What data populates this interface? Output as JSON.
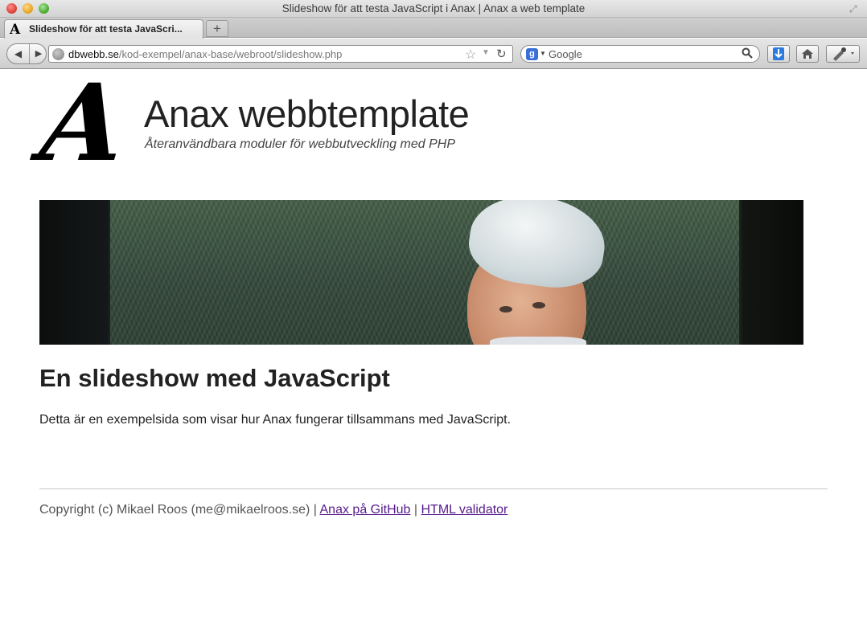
{
  "window": {
    "title": "Slideshow för att testa JavaScript i Anax | Anax a web template"
  },
  "tab": {
    "favicon_letter": "A",
    "title": "Slideshow för att testa JavaScri..."
  },
  "new_tab_label": "+",
  "nav": {
    "url_domain": "dbwebb.se",
    "url_path": "/kod-exempel/anax-base/webroot/slideshow.php",
    "search_engine": "Google",
    "search_engine_letter": "g"
  },
  "site": {
    "logo_letter": "A",
    "title": "Anax webbtemplate",
    "slogan": "Återanvändbara moduler för webbutveckling med PHP"
  },
  "main": {
    "heading": "En slideshow med JavaScript",
    "text": "Detta är en exempelsida som visar hur Anax fungerar tillsammans med JavaScript."
  },
  "footer": {
    "copyright": "Copyright (c) Mikael Roos (me@mikaelroos.se) | ",
    "link_github": "Anax på GitHub",
    "separator": " | ",
    "link_validator": "HTML validator"
  },
  "colors": {
    "link_visited": "#551a8b",
    "text": "#222222"
  }
}
